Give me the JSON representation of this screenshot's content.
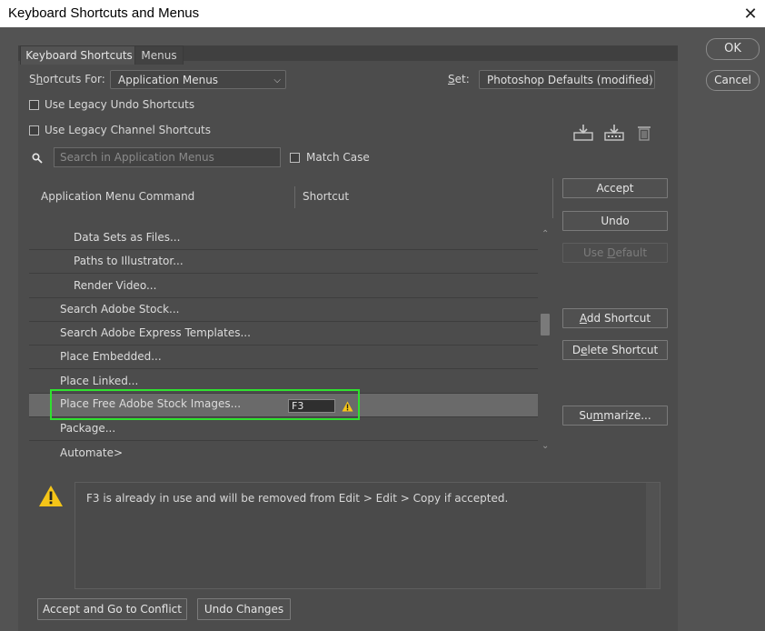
{
  "window": {
    "title": "Keyboard Shortcuts and Menus",
    "close_glyph": "✕"
  },
  "tabs": [
    {
      "label": "Keyboard Shortcuts",
      "active": true
    },
    {
      "label": "Menus",
      "active": false
    }
  ],
  "shortcuts_for": {
    "label_pre": "S",
    "label_ul": "h",
    "label_post": "ortcuts For:",
    "value": "Application Menus"
  },
  "set": {
    "label_ul": "S",
    "label_post": "et:",
    "value": "Photoshop Defaults (modified)"
  },
  "options": {
    "legacy_undo": "Use Legacy Undo Shortcuts",
    "legacy_channel": "Use Legacy Channel Shortcuts",
    "match_case": "Match Case"
  },
  "search": {
    "placeholder": "Search in Application Menus"
  },
  "columns": {
    "command": "Application Menu Command",
    "shortcut": "Shortcut"
  },
  "rows": [
    {
      "label": "Data Sets as Files..."
    },
    {
      "label": "Paths to Illustrator..."
    },
    {
      "label": "Render Video..."
    },
    {
      "label": "Search Adobe Stock..."
    },
    {
      "label": "Search Adobe Express Templates..."
    },
    {
      "label": "Place Embedded..."
    },
    {
      "label": "Place Linked..."
    },
    {
      "label": "Place Free Adobe Stock Images...",
      "shortcut": "F3"
    },
    {
      "label": "Package..."
    },
    {
      "label": "Automate>"
    }
  ],
  "right_buttons": {
    "ok": "OK",
    "cancel": "Cancel",
    "accept": "Accept",
    "undo": "Undo",
    "use_default_pre": "Use ",
    "use_default_ul": "D",
    "use_default_post": "efault",
    "add_shortcut_pre": "",
    "add_shortcut_ul": "A",
    "add_shortcut_post": "dd Shortcut",
    "delete_shortcut_pre": "D",
    "delete_shortcut_ul": "e",
    "delete_shortcut_post": "lete Shortcut",
    "summarize_pre": "Su",
    "summarize_ul": "m",
    "summarize_post": "marize..."
  },
  "message": "F3 is already in use and will be removed from Edit > Edit > Copy if accepted.",
  "bottom_buttons": {
    "accept_conflict": "Accept and Go to Conflict",
    "undo_changes": "Undo Changes"
  },
  "colors": {
    "highlight": "#2fe12f",
    "warning": "#f5c518"
  }
}
